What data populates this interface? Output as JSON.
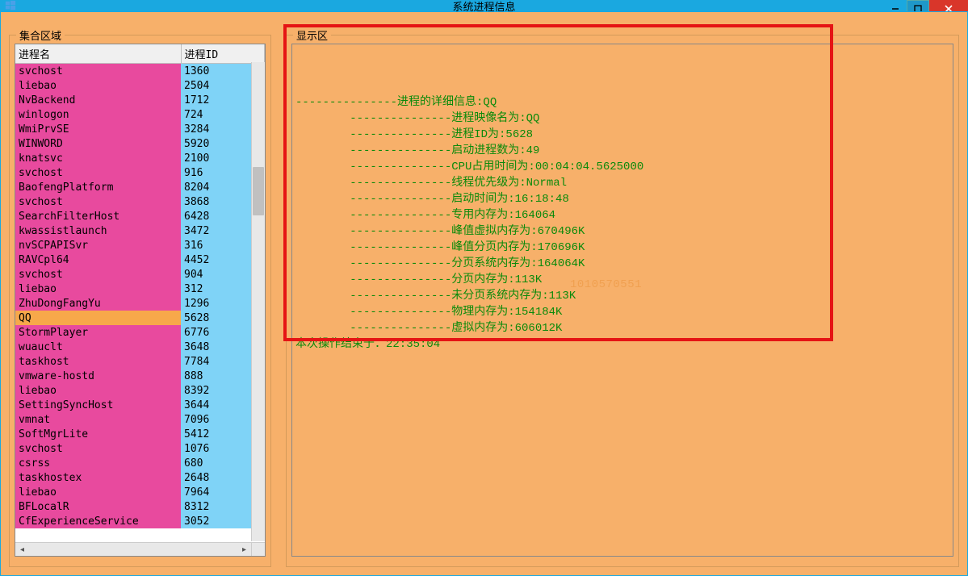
{
  "window": {
    "title": "系统进程信息",
    "min": "—",
    "max": "☐",
    "close": "✕"
  },
  "left": {
    "label": "集合区域",
    "columns": {
      "name": "进程名",
      "pid": "进程ID"
    },
    "rows": [
      {
        "name": "svchost",
        "pid": "1360"
      },
      {
        "name": "liebao",
        "pid": "2504"
      },
      {
        "name": "NvBackend",
        "pid": "1712"
      },
      {
        "name": "winlogon",
        "pid": "724"
      },
      {
        "name": "WmiPrvSE",
        "pid": "3284"
      },
      {
        "name": "WINWORD",
        "pid": "5920"
      },
      {
        "name": "knatsvc",
        "pid": "2100"
      },
      {
        "name": "svchost",
        "pid": "916"
      },
      {
        "name": "BaofengPlatform",
        "pid": "8204"
      },
      {
        "name": "svchost",
        "pid": "3868"
      },
      {
        "name": "SearchFilterHost",
        "pid": "6428"
      },
      {
        "name": "kwassistlaunch",
        "pid": "3472"
      },
      {
        "name": "nvSCPAPISvr",
        "pid": "316"
      },
      {
        "name": "RAVCpl64",
        "pid": "4452"
      },
      {
        "name": "svchost",
        "pid": "904"
      },
      {
        "name": "liebao",
        "pid": "312"
      },
      {
        "name": "ZhuDongFangYu",
        "pid": "1296"
      },
      {
        "name": "QQ",
        "pid": "5628",
        "selected": true
      },
      {
        "name": "StormPlayer",
        "pid": "6776"
      },
      {
        "name": "wuauclt",
        "pid": "3648"
      },
      {
        "name": "taskhost",
        "pid": "7784"
      },
      {
        "name": "vmware-hostd",
        "pid": "888"
      },
      {
        "name": "liebao",
        "pid": "8392"
      },
      {
        "name": "SettingSyncHost",
        "pid": "3644"
      },
      {
        "name": "vmnat",
        "pid": "7096"
      },
      {
        "name": "SoftMgrLite",
        "pid": "5412"
      },
      {
        "name": "svchost",
        "pid": "1076"
      },
      {
        "name": "csrss",
        "pid": "680"
      },
      {
        "name": "taskhostex",
        "pid": "2648"
      },
      {
        "name": "liebao",
        "pid": "7964"
      },
      {
        "name": "BFLocalR",
        "pid": "8312"
      },
      {
        "name": "CfExperienceService",
        "pid": "3052"
      }
    ]
  },
  "right": {
    "label": "显示区",
    "watermark": "1010570551",
    "lines": [
      "---------------进程的详细信息:QQ",
      "        ---------------进程映像名为:QQ",
      "        ---------------进程ID为:5628",
      "        ---------------启动进程数为:49",
      "        ---------------CPU占用时间为:00:04:04.5625000",
      "        ---------------线程优先级为:Normal",
      "        ---------------启动时间为:16:18:48",
      "        ---------------专用内存为:164064",
      "        ---------------峰值虚拟内存为:670496K",
      "        ---------------峰值分页内存为:170696K",
      "        ---------------分页系统内存为:164064K",
      "        ---------------分页内存为:113K",
      "        ---------------未分页系统内存为:113K",
      "        ---------------物理内存为:154184K",
      "        ---------------虛拟内存为:606012K",
      "本次操作结束于：22:35:04"
    ]
  }
}
